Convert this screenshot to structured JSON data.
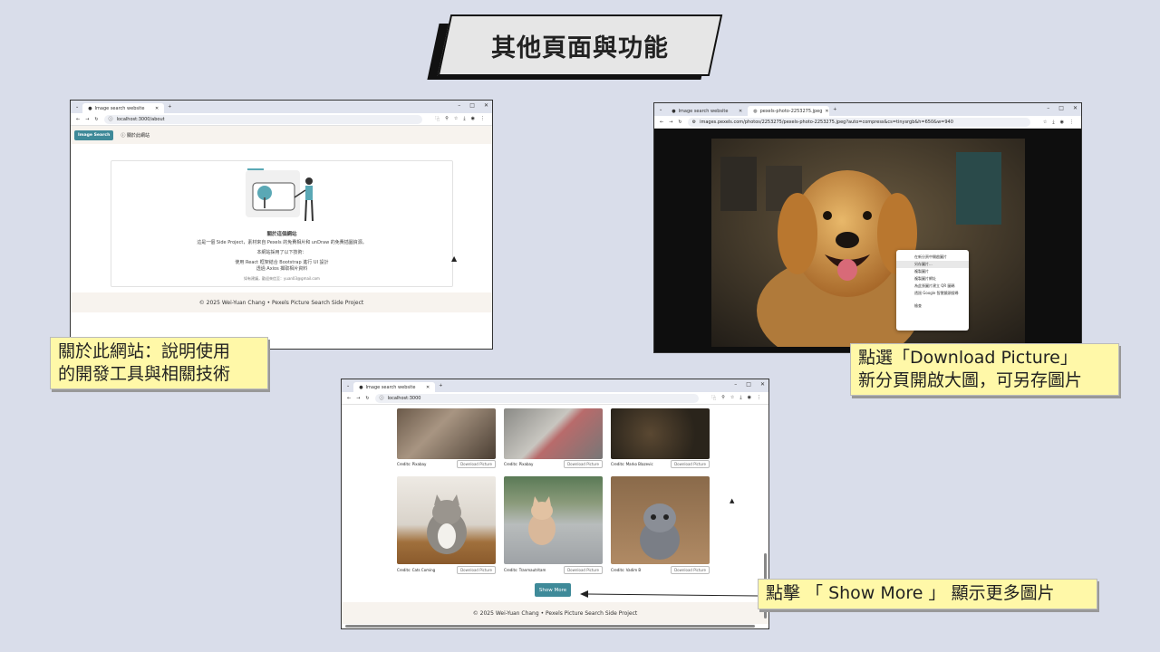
{
  "slide": {
    "title": "其他頁面與功能",
    "caption_about": [
      "關於此網站：說明使用",
      "的開發工具與相關技術"
    ],
    "caption_pexels": [
      "點選「Download Picture」",
      "新分頁開啟大圖，可另存圖片"
    ],
    "caption_showmore": "點擊 「 Show More 」 顯示更多圖片"
  },
  "about_window": {
    "tab_label": "Image search website",
    "url": "localhost:3000/about",
    "nav_brand": "Image Search",
    "nav_about": "關於此網站",
    "card_title": "關於這個網站",
    "card_desc": "這是一個 Side Project，素材來自 Pexels 的免費相片和 unDraw 的免費插圖資源。",
    "card_tech_intro": "本網站採用了以下技術：",
    "card_tech_1": "使用 React 框架結合 Bootstrap 進行 UI 設計",
    "card_tech_2": "透過 Axios 擷取相片資料",
    "card_contact": "如有建議，歡迎來信至：yuan03@gmail.com",
    "footer": "© 2025 Wei-Yuan Chang • Pexels Picture Search Side Project"
  },
  "pexels_window": {
    "tab1_label": "Image search website",
    "tab2_label": "pexels-photo-2253275.jpeg",
    "url": "images.pexels.com/photos/2253275/pexels-photo-2253275.jpeg?auto=compress&cs=tinysrgb&h=650&w=940",
    "context_menu": [
      "在新分頁中開啟圖片",
      "另存圖片...",
      "複製圖片",
      "複製圖片網址",
      "為此張圖片建立 QR 圖碼",
      "透過 Google 智慧鏡頭搜尋",
      "檢查"
    ]
  },
  "gallery_window": {
    "tab_label": "Image search website",
    "url": "localhost:3000",
    "download_label": "Download Picture",
    "top_row_credits": [
      "Credits: Pixabay",
      "Credits: Pixabay",
      "Credits: Marko Blazevic"
    ],
    "bottom_row_credits": [
      "Credits: Cats Coming",
      "Credits: Tranmautritam",
      "Credits: Vadim B"
    ],
    "show_more": "Show More",
    "footer": "© 2025 Wei-Yuan Chang • Pexels Picture Search Side Project"
  },
  "window_controls": [
    "–",
    "□",
    "✕"
  ],
  "colors": {
    "background": "#d9ddea",
    "accent": "#3f8a99",
    "caption_bg": "#fff8a8",
    "nav_bg": "#f7f3ee"
  }
}
